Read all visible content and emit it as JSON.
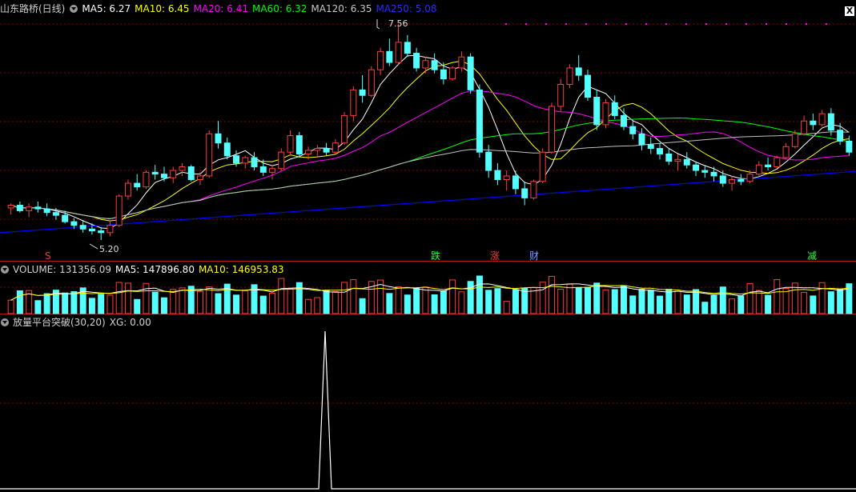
{
  "price_header": {
    "title": "山东路桥(日线)",
    "ma5": "MA5: 6.27",
    "ma10": "MA10: 6.45",
    "ma20": "MA20: 6.41",
    "ma60": "MA60: 6.32",
    "ma120": "MA120: 6.35",
    "ma250": "MA250: 5.08"
  },
  "volume_header": {
    "vol": "VOLUME: 131356.09",
    "ma5": "MA5: 147896.80",
    "ma10": "MA10: 146953.83"
  },
  "indicator_header": {
    "name": "放量平台突破(30,20)",
    "xg": "XG: 0.00"
  },
  "annotations": {
    "high": "7.56",
    "low": "5.20"
  },
  "signals": {
    "s1": "S",
    "s2": "跌",
    "s3": "涨",
    "s4": "财",
    "s5": "减"
  },
  "close_label": "X",
  "colors": {
    "up": "#ff3c3c",
    "down": "#54ffff",
    "ma5": "#ffffff",
    "ma10": "#ffff00",
    "ma20": "#ff00ff",
    "ma60": "#00ff00",
    "ma120": "#c0c0c0",
    "ma250": "#0000ff",
    "grid": "#8b0000"
  },
  "chart_data": {
    "type": "candlestick",
    "stock": "山东路桥",
    "period": "日线",
    "price_range": [
      5.2,
      7.56
    ],
    "ohlc": [
      [
        5.55,
        5.6,
        5.48,
        5.58
      ],
      [
        5.58,
        5.62,
        5.5,
        5.52
      ],
      [
        5.52,
        5.6,
        5.45,
        5.56
      ],
      [
        5.56,
        5.62,
        5.5,
        5.54
      ],
      [
        5.54,
        5.6,
        5.46,
        5.5
      ],
      [
        5.5,
        5.55,
        5.42,
        5.47
      ],
      [
        5.47,
        5.52,
        5.38,
        5.4
      ],
      [
        5.4,
        5.44,
        5.32,
        5.36
      ],
      [
        5.36,
        5.42,
        5.28,
        5.32
      ],
      [
        5.32,
        5.38,
        5.26,
        5.3
      ],
      [
        5.3,
        5.34,
        5.2,
        5.28
      ],
      [
        5.28,
        5.4,
        5.24,
        5.36
      ],
      [
        5.36,
        5.7,
        5.34,
        5.68
      ],
      [
        5.68,
        5.86,
        5.64,
        5.82
      ],
      [
        5.82,
        5.92,
        5.74,
        5.78
      ],
      [
        5.78,
        5.96,
        5.76,
        5.94
      ],
      [
        5.94,
        6.02,
        5.86,
        5.92
      ],
      [
        5.92,
        6.0,
        5.84,
        5.88
      ],
      [
        5.88,
        6.0,
        5.82,
        5.96
      ],
      [
        5.96,
        6.04,
        5.9,
        6.0
      ],
      [
        6.0,
        6.02,
        5.84,
        5.86
      ],
      [
        5.86,
        5.94,
        5.8,
        5.9
      ],
      [
        5.9,
        6.4,
        5.88,
        6.36
      ],
      [
        6.36,
        6.5,
        6.2,
        6.26
      ],
      [
        6.26,
        6.32,
        6.08,
        6.12
      ],
      [
        6.12,
        6.18,
        6.0,
        6.04
      ],
      [
        6.04,
        6.12,
        5.98,
        6.1
      ],
      [
        6.1,
        6.16,
        5.96,
        6.0
      ],
      [
        6.0,
        6.08,
        5.9,
        5.94
      ],
      [
        5.94,
        6.02,
        5.86,
        5.98
      ],
      [
        5.98,
        6.2,
        5.96,
        6.16
      ],
      [
        6.16,
        6.4,
        6.12,
        6.34
      ],
      [
        6.34,
        6.38,
        6.1,
        6.14
      ],
      [
        6.14,
        6.22,
        6.08,
        6.18
      ],
      [
        6.18,
        6.24,
        6.1,
        6.2
      ],
      [
        6.2,
        6.26,
        6.12,
        6.16
      ],
      [
        6.16,
        6.3,
        6.14,
        6.26
      ],
      [
        6.26,
        6.6,
        6.24,
        6.56
      ],
      [
        6.56,
        6.88,
        6.5,
        6.84
      ],
      [
        6.84,
        7.0,
        6.7,
        6.78
      ],
      [
        6.78,
        7.1,
        6.76,
        7.06
      ],
      [
        7.06,
        7.3,
        7.0,
        7.26
      ],
      [
        7.26,
        7.4,
        7.1,
        7.14
      ],
      [
        7.14,
        7.56,
        7.12,
        7.36
      ],
      [
        7.36,
        7.44,
        7.2,
        7.24
      ],
      [
        7.24,
        7.3,
        7.04,
        7.08
      ],
      [
        7.08,
        7.2,
        7.02,
        7.16
      ],
      [
        7.16,
        7.24,
        7.02,
        7.06
      ],
      [
        7.06,
        7.14,
        6.9,
        6.96
      ],
      [
        6.96,
        7.1,
        6.94,
        7.08
      ],
      [
        7.08,
        7.26,
        7.04,
        7.2
      ],
      [
        7.2,
        7.24,
        6.8,
        6.84
      ],
      [
        6.84,
        6.9,
        6.1,
        6.16
      ],
      [
        6.16,
        6.24,
        5.88,
        5.96
      ],
      [
        5.96,
        6.04,
        5.8,
        5.86
      ],
      [
        5.86,
        5.96,
        5.74,
        5.9
      ],
      [
        5.9,
        5.96,
        5.7,
        5.76
      ],
      [
        5.76,
        5.84,
        5.58,
        5.66
      ],
      [
        5.66,
        5.86,
        5.64,
        5.84
      ],
      [
        5.84,
        6.2,
        5.82,
        6.16
      ],
      [
        6.16,
        6.7,
        6.14,
        6.66
      ],
      [
        6.66,
        6.96,
        6.6,
        6.9
      ],
      [
        6.9,
        7.12,
        6.86,
        7.08
      ],
      [
        7.08,
        7.22,
        6.94,
        7.0
      ],
      [
        7.0,
        7.06,
        6.72,
        6.76
      ],
      [
        6.76,
        6.84,
        6.4,
        6.46
      ],
      [
        6.46,
        6.74,
        6.42,
        6.7
      ],
      [
        6.7,
        6.78,
        6.52,
        6.56
      ],
      [
        6.56,
        6.64,
        6.4,
        6.44
      ],
      [
        6.44,
        6.5,
        6.3,
        6.36
      ],
      [
        6.36,
        6.42,
        6.18,
        6.24
      ],
      [
        6.24,
        6.32,
        6.14,
        6.2
      ],
      [
        6.2,
        6.26,
        6.08,
        6.14
      ],
      [
        6.14,
        6.2,
        6.02,
        6.06
      ],
      [
        6.06,
        6.14,
        5.96,
        6.08
      ],
      [
        6.08,
        6.16,
        5.98,
        6.02
      ],
      [
        6.02,
        6.06,
        5.9,
        5.96
      ],
      [
        5.96,
        6.02,
        5.88,
        5.94
      ],
      [
        5.94,
        6.0,
        5.84,
        5.9
      ],
      [
        5.9,
        5.96,
        5.78,
        5.82
      ],
      [
        5.82,
        5.9,
        5.74,
        5.86
      ],
      [
        5.86,
        5.92,
        5.8,
        5.84
      ],
      [
        5.84,
        5.96,
        5.82,
        5.92
      ],
      [
        5.92,
        6.06,
        5.9,
        6.02
      ],
      [
        6.02,
        6.1,
        5.96,
        6.0
      ],
      [
        6.0,
        6.12,
        5.98,
        6.1
      ],
      [
        6.1,
        6.26,
        6.08,
        6.22
      ],
      [
        6.22,
        6.4,
        6.2,
        6.36
      ],
      [
        6.36,
        6.56,
        6.34,
        6.5
      ],
      [
        6.5,
        6.58,
        6.4,
        6.46
      ],
      [
        6.46,
        6.62,
        6.44,
        6.58
      ],
      [
        6.58,
        6.64,
        6.34,
        6.4
      ],
      [
        6.4,
        6.48,
        6.24,
        6.28
      ],
      [
        6.28,
        6.34,
        6.12,
        6.16
      ]
    ],
    "volume_range_note": "relative bar heights",
    "xg_signal_peak_index": 48
  }
}
